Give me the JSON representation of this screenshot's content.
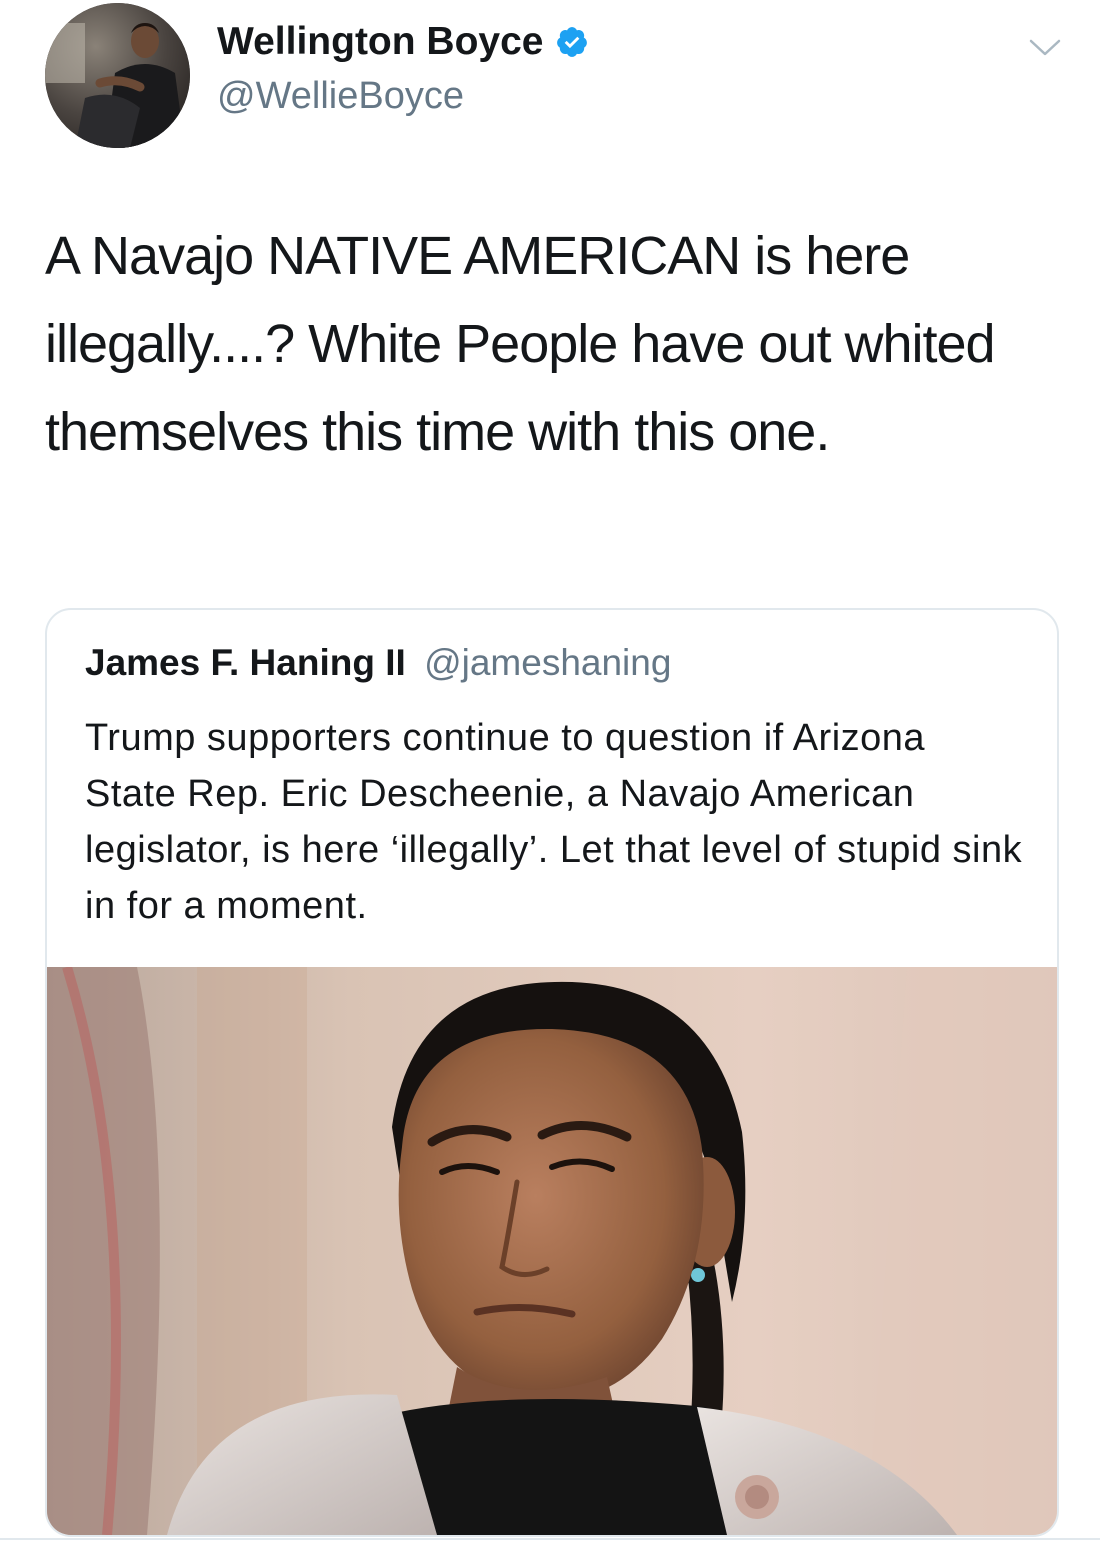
{
  "tweet": {
    "author": {
      "name": "Wellington Boyce",
      "handle": "@WellieBoyce",
      "verified": true,
      "avatar_icon": "user-avatar-photo"
    },
    "menu_icon": "chevron-down-icon",
    "text": "A Navajo NATIVE AMERICAN is here illegally....? White People have out whited themselves this time with this one.",
    "quoted_tweet": {
      "author_name": "James F. Haning II",
      "author_handle": "@jameshaning",
      "text": "Trump supporters continue to question if Arizona State Rep. Eric Descheenie, a Navajo American legislator, is here ‘illegally’. Let that level of stupid sink in for a moment.",
      "media_icon": "portrait-photo"
    }
  },
  "colors": {
    "text_primary": "#14171a",
    "text_secondary": "#657786",
    "verified_blue": "#1da1f2",
    "border": "#e1e8ed"
  }
}
